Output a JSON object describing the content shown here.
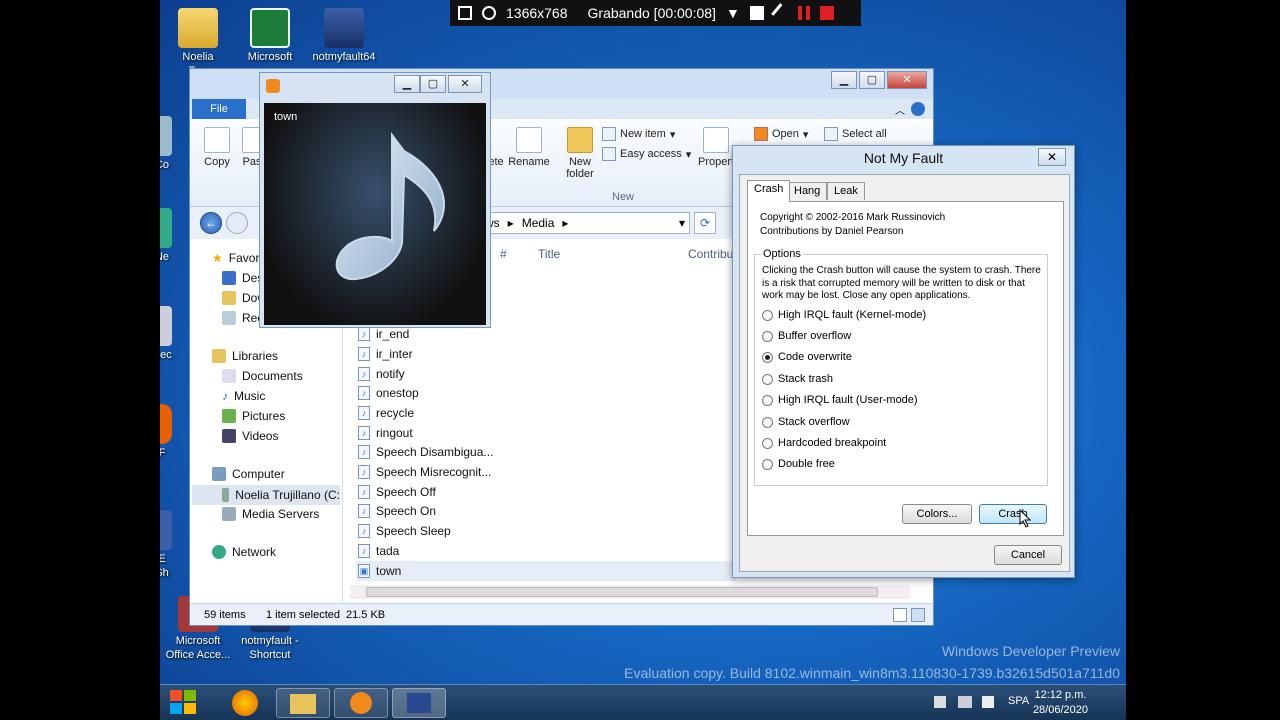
{
  "recording_bar": {
    "resolution": "1366x768",
    "status": "Grabando [00:00:08]"
  },
  "desktop_icons": [
    {
      "label": "Noelia\nTr..."
    },
    {
      "label": "Microsoft"
    },
    {
      "label": "notmyfault64"
    },
    {
      "label": "Co"
    },
    {
      "label": "Ne"
    },
    {
      "label": "Rec"
    },
    {
      "label": "F"
    },
    {
      "label": "E\nSh"
    },
    {
      "label": "Microsoft\nOffice Acce..."
    },
    {
      "label": "notmyfault -\nShortcut"
    }
  ],
  "explorer": {
    "file_tab": "File",
    "ribbon": {
      "copy": "Copy",
      "paste": "Pas",
      "delete": "ete",
      "rename": "Rename",
      "new_folder": "New\nfolder",
      "new_item": "New item",
      "easy_access": "Easy access",
      "new_group": "New",
      "open": "Open",
      "properties": "Propert",
      "select_all": "Select all"
    },
    "address": {
      "part1": "ws",
      "part2": "Media"
    },
    "columns": {
      "num": "#",
      "title": "Title",
      "contrib": "Contribu"
    },
    "nav": [
      "Favor",
      "Des",
      "Dow",
      "Rec",
      "Libraries",
      "Documents",
      "Music",
      "Pictures",
      "Videos",
      "Computer",
      "Noelia Trujillano (C:",
      "Media Servers",
      "Network"
    ],
    "files": [
      "ir_end",
      "ir_inter",
      "notify",
      "onestop",
      "recycle",
      "ringout",
      "Speech Disambigua...",
      "Speech Misrecognit...",
      "Speech Off",
      "Speech On",
      "Speech Sleep",
      "tada",
      "town"
    ],
    "status": {
      "count": "59 items",
      "selected": "1 item selected",
      "size": "21.5 KB"
    }
  },
  "player": {
    "title": "town"
  },
  "notmyfault": {
    "title": "Not My Fault",
    "tabs": [
      "Crash",
      "Hang",
      "Leak"
    ],
    "copyright": "Copyright © 2002-2016 Mark Russinovich",
    "contrib": "Contributions by Daniel Pearson",
    "options_label": "Options",
    "warning": "Clicking the Crash button will cause the system to crash. There is a risk that corrupted memory will be written to disk or that work may be lost. Close any open applications.",
    "options": [
      "High IRQL fault (Kernel-mode)",
      "Buffer overflow",
      "Code overwrite",
      "Stack trash",
      "High IRQL fault (User-mode)",
      "Stack overflow",
      "Hardcoded breakpoint",
      "Double free"
    ],
    "selected_option": "Code overwrite",
    "colors_button": "Colors...",
    "crash_button": "Crash",
    "cancel_button": "Cancel"
  },
  "watermark": {
    "line1": "Windows Developer Preview",
    "line2": "Evaluation copy. Build 8102.winmain_win8m3.110830-1739.b32615d501a711d0"
  },
  "taskbar": {
    "lang": "SPA",
    "time": "12:12 p.m.",
    "date": "28/06/2020"
  }
}
